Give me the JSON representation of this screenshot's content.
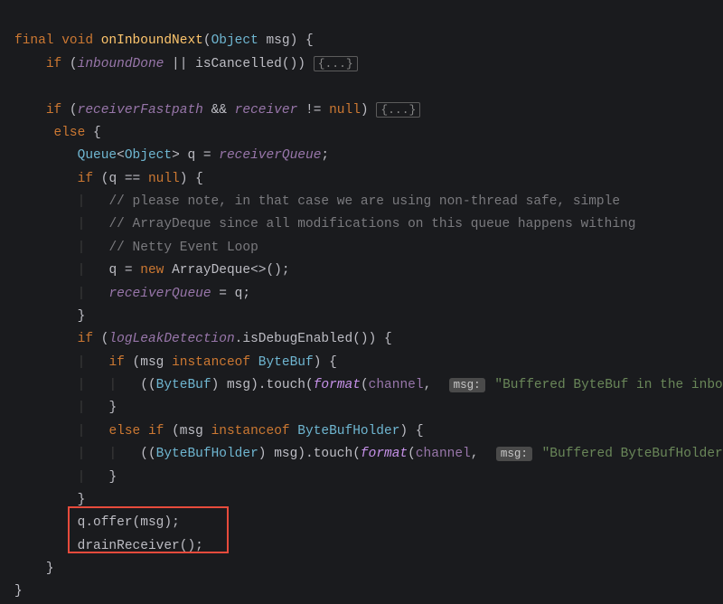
{
  "code": {
    "l1": {
      "kw_final": "final",
      "kw_void": "void",
      "method": "onInboundNext",
      "param_type": "Object",
      "param_name": "msg",
      "brace": "{"
    },
    "l2": {
      "kw_if": "if",
      "field1": "inboundDone",
      "op_or": "||",
      "method": "isCancelled",
      "fold": "{...}"
    },
    "l3": {
      "kw_if": "if",
      "field1": "receiverFastpath",
      "op_and": "&&",
      "field2": "receiver",
      "op_ne": "!=",
      "kw_null": "null",
      "fold": "{...}"
    },
    "l4": {
      "kw_else": "else",
      "brace": "{"
    },
    "l5": {
      "type1": "Queue",
      "type2": "Object",
      "var": "q",
      "op": "=",
      "field": "receiverQueue",
      "semi": ";"
    },
    "l6": {
      "kw_if": "if",
      "var": "q",
      "op_eq": "==",
      "kw_null": "null",
      "brace": "{"
    },
    "l7": {
      "comment": "// please note, in that case we are using non-thread safe, simple"
    },
    "l8": {
      "comment": "// ArrayDeque since all modifications on this queue happens withing"
    },
    "l9": {
      "comment": "// Netty Event Loop"
    },
    "l10": {
      "var": "q",
      "op": "=",
      "kw_new": "new",
      "type": "ArrayDeque",
      "generics": "<>",
      "parens": "()",
      "semi": ";"
    },
    "l11": {
      "field": "receiverQueue",
      "op": "=",
      "var": "q",
      "semi": ";"
    },
    "l12": {
      "brace": "}"
    },
    "l13": {
      "kw_if": "if",
      "field": "logLeakDetection",
      "method": "isDebugEnabled",
      "brace": "{"
    },
    "l14": {
      "kw_if": "if",
      "var": "msg",
      "kw_instanceof": "instanceof",
      "type": "ByteBuf",
      "brace": "{"
    },
    "l15": {
      "cast_type": "ByteBuf",
      "var": "msg",
      "method1": "touch",
      "method2": "format",
      "field": "channel",
      "hint": "msg:",
      "string": "\"Buffered ByteBuf in the inbo"
    },
    "l16": {
      "brace": "}"
    },
    "l17": {
      "kw_else": "else",
      "kw_if": "if",
      "var": "msg",
      "kw_instanceof": "instanceof",
      "type": "ByteBufHolder",
      "brace": "{"
    },
    "l18": {
      "cast_type": "ByteBufHolder",
      "var": "msg",
      "method1": "touch",
      "method2": "format",
      "field": "channel",
      "hint": "msg:",
      "string": "\"Buffered ByteBufHolder"
    },
    "l19": {
      "brace": "}"
    },
    "l20": {
      "brace": "}"
    },
    "l21": {
      "var": "q",
      "method": "offer",
      "arg": "msg",
      "semi": ";"
    },
    "l22": {
      "method": "drainReceiver",
      "semi": ";"
    },
    "l23": {
      "brace": "}"
    },
    "l24": {
      "brace": "}"
    }
  }
}
